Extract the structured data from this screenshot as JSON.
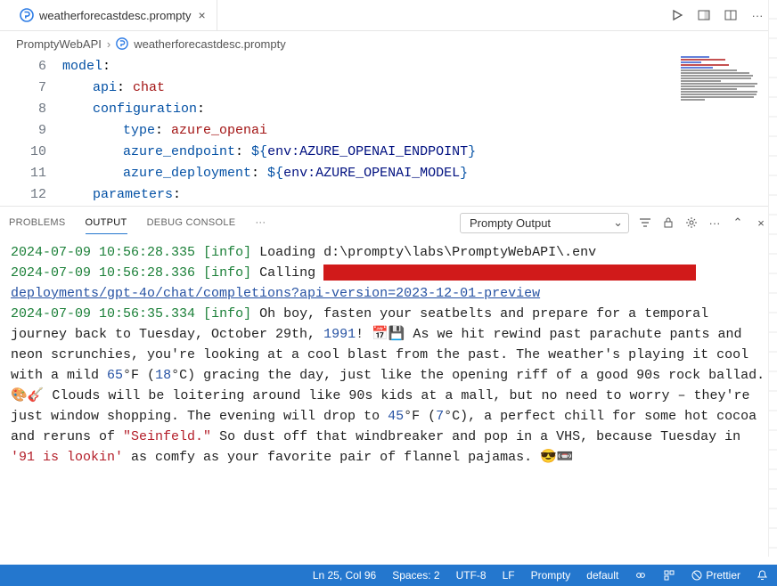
{
  "tab": {
    "label": "weatherforecastdesc.prompty"
  },
  "breadcrumb": {
    "root": "PromptyWebAPI",
    "file": "weatherforecastdesc.prompty"
  },
  "editor": {
    "lines": [
      {
        "n": 6,
        "html": "<span class='k-key'>model</span>:"
      },
      {
        "n": 7,
        "html": "<span class='ind'></span><span class='k-key'>api</span>: <span class='k-str'>chat</span>"
      },
      {
        "n": 8,
        "html": "<span class='ind'></span><span class='k-key'>configuration</span>:"
      },
      {
        "n": 9,
        "html": "<span class='ind2'></span><span class='k-key'>type</span>: <span class='k-str'>azure_openai</span>"
      },
      {
        "n": 10,
        "html": "<span class='ind2'></span><span class='k-key'>azure_endpoint</span>: <span class='k-dollar'>${</span><span class='k-int'>env:AZURE_OPENAI_ENDPOINT</span><span class='k-dollar'>}</span>"
      },
      {
        "n": 11,
        "html": "<span class='ind2'></span><span class='k-key'>azure_deployment</span>: <span class='k-dollar'>${</span><span class='k-int'>env:AZURE_OPENAI_MODEL</span><span class='k-dollar'>}</span>"
      },
      {
        "n": 12,
        "html": "<span class='ind'></span><span class='k-key'>parameters</span>:"
      }
    ]
  },
  "panel": {
    "tabs": {
      "problems": "PROBLEMS",
      "output": "OUTPUT",
      "debug": "DEBUG CONSOLE"
    },
    "channel": "Prompty Output"
  },
  "log": {
    "l1_ts": "2024-07-09 10:56:28.335",
    "l1_lvl": "[info]",
    "l1_msg": "Loading d:\\prompty\\labs\\PromptyWebAPI\\.env",
    "l2_ts": "2024-07-09 10:56:28.336",
    "l2_lvl": "[info]",
    "l2_msg": "Calling ",
    "l3_url": "deployments/gpt-4o/chat/completions?api-version=2023-12-01-preview",
    "l4_ts": "2024-07-09 10:56:35.334",
    "l4_lvl": "[info]",
    "body_a": "Oh boy, fasten your seatbelts and prepare for a temporal journey back to Tuesday, October 29th, ",
    "body_year": "1991",
    "body_b": "! 📅💾 As we hit rewind past parachute pants and neon scrunchies, you're looking at a cool blast from the past. The weather's playing it cool with a mild ",
    "body_t1": "65",
    "body_c": "°F (",
    "body_t2": "18",
    "body_d": "°C) gracing the day, just like the opening riff of a good 90s rock ballad. 🎨🎸 Clouds will be loitering around like 90s kids at a mall, but no need to worry – they're just window shopping. The evening will drop to ",
    "body_t3": "45",
    "body_e": "°F (",
    "body_t4": "7",
    "body_f": "°C), a perfect chill for some hot cocoa and reruns of ",
    "body_q": "\"Seinfeld.\"",
    "body_g": " So dust off that windbreaker and pop in a VHS, because Tuesday in ",
    "body_q2": "'91 is lookin'",
    "body_h": " as comfy as your favorite pair of flannel pajamas. 😎📼"
  },
  "status": {
    "pos": "Ln 25, Col 96",
    "spaces": "Spaces: 2",
    "enc": "UTF-8",
    "eol": "LF",
    "lang": "Prompty",
    "profile": "default",
    "prettier": "Prettier"
  }
}
